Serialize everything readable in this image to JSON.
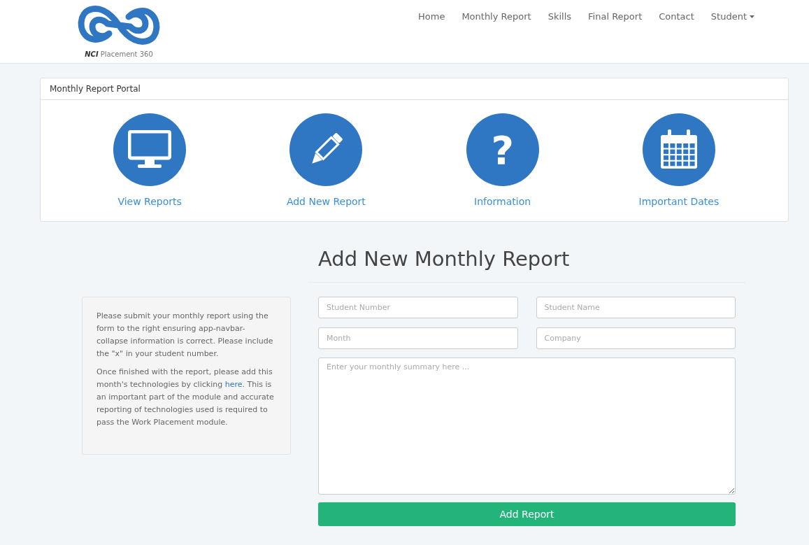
{
  "brand": {
    "name": "**NCI** Placement 360"
  },
  "nav": [
    {
      "label": "Home",
      "dropdown": false
    },
    {
      "label": "Monthly Report",
      "dropdown": false
    },
    {
      "label": "Skills",
      "dropdown": false
    },
    {
      "label": "Final Report",
      "dropdown": false
    },
    {
      "label": "Contact",
      "dropdown": false
    },
    {
      "label": "Student",
      "dropdown": true
    }
  ],
  "portal": {
    "title": "Monthly Report Portal",
    "actions": [
      {
        "kind": "monitor",
        "label": "View Reports"
      },
      {
        "kind": "pencil",
        "label": "Add New Report"
      },
      {
        "kind": "question",
        "label": "Information",
        "glyph": "?"
      },
      {
        "kind": "calendar",
        "label": "Important Dates"
      }
    ]
  },
  "form": {
    "heading": "Add New Monthly Report",
    "info": {
      "paragraph_1": "Please submit your monthly report using the form to the right ensuring app-navbar-collapse information is correct. Please include the \"x\" in your student number.",
      "paragraph_2": {
        "before": "Once finished with the report, please add this month's technologies by clicking ",
        "link": "here",
        "after": ". This is an important part of the module and accurate reporting of technologies used is required to pass the Work Placement module."
      }
    },
    "fields": [
      {
        "placeholder": "Student Number"
      },
      {
        "placeholder": "Student Name"
      },
      {
        "placeholder": "Month"
      },
      {
        "placeholder": "Company"
      }
    ],
    "summary": {
      "placeholder": "Enter your monthly summary here ..."
    },
    "submit": "Add Report"
  }
}
